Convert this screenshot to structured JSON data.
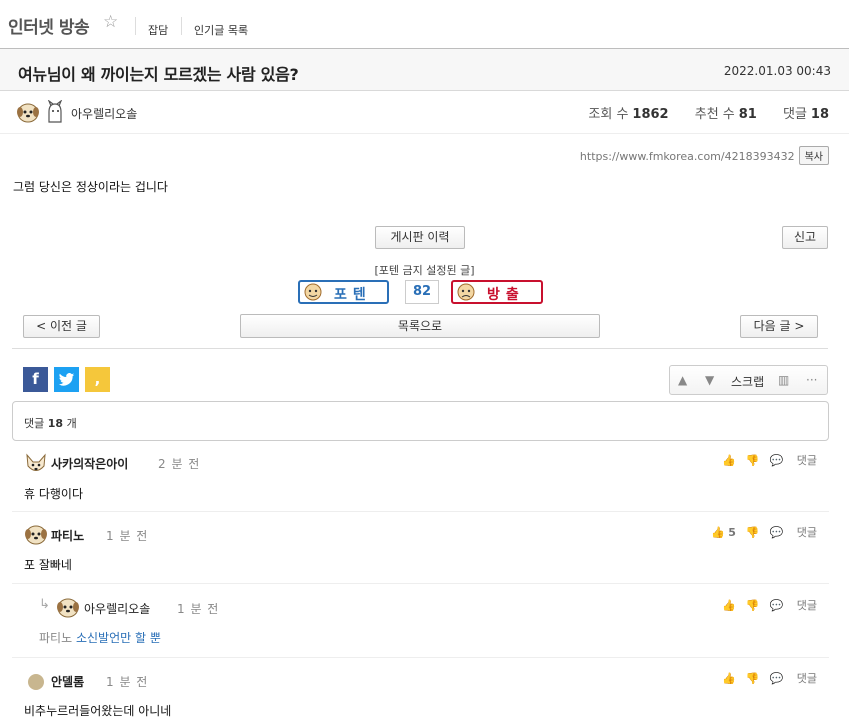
{
  "board": {
    "title": "인터넷 방송",
    "tabs": [
      "잡담",
      "인기글 목록"
    ]
  },
  "post": {
    "title": "여뉴님이 왜 까이는지 모르겠는 사람 있음?",
    "date": "2022.01.03 00:43",
    "author": "아우렐리오솔",
    "views_label": "조회 수",
    "views": "1862",
    "recommend_label": "추천 수",
    "recommend": "81",
    "comments_label": "댓글",
    "comments": "18",
    "url": "https://www.fmkorea.com/4218393432",
    "copy_label": "복사",
    "content": "그럼 당신은 정상이라는 겁니다"
  },
  "buttons": {
    "history": "게시판 이력",
    "report": "신고",
    "prev": "< 이전 글",
    "list": "목록으로",
    "next": "다음 글 >"
  },
  "vote": {
    "notice": "[포텐 금지 설정된 글]",
    "up_label": "포텐",
    "count": "82",
    "down_label": "방출"
  },
  "tools": {
    "scrap_label": "스크랩"
  },
  "comment_section": {
    "label": "댓글",
    "count": "18",
    "unit": "개"
  },
  "comments": [
    {
      "name": "사카의작은아이",
      "time": "2 분 전",
      "text": "휴 다행이다",
      "likes": "",
      "reply_label": "댓글"
    },
    {
      "name": "파티노",
      "time": "1 분 전",
      "text": "포 잘빠네",
      "likes": "5",
      "reply_label": "댓글"
    },
    {
      "name": "아우렐리오솔",
      "time": "1 분 전",
      "reply_to": "파티노",
      "text": "소신발언만 할 뿐",
      "likes": "",
      "reply_label": "댓글"
    },
    {
      "name": "안델롬",
      "time": "1 분 전",
      "text": "비추누르러들어왔는데 아니네",
      "likes": "",
      "reply_label": "댓글"
    }
  ],
  "colors": {
    "facebook": "#3b5998",
    "twitter": "#1da1f2",
    "kakao": "#f5c73b",
    "potent_blue": "#2a6fb7",
    "release_red": "#c8102e"
  }
}
